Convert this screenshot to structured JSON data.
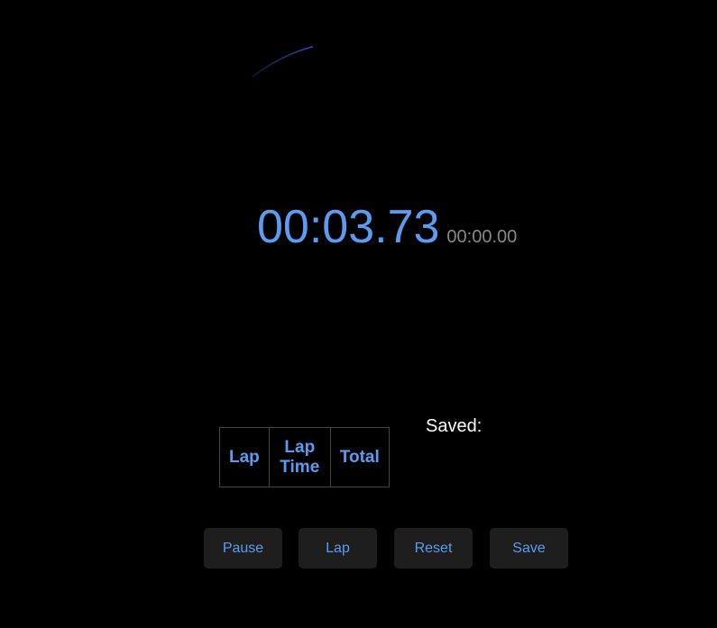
{
  "stopwatch": {
    "main_time": "00:03.73",
    "lap_time": "00:00.00",
    "progress": 0.062,
    "accent_color": "#5b9cf0"
  },
  "laps_table": {
    "headers": [
      "Lap",
      "Lap Time",
      "Total"
    ],
    "rows": []
  },
  "saved": {
    "label": "Saved:"
  },
  "controls": {
    "pause_label": "Pause",
    "lap_label": "Lap",
    "reset_label": "Reset",
    "save_label": "Save"
  }
}
